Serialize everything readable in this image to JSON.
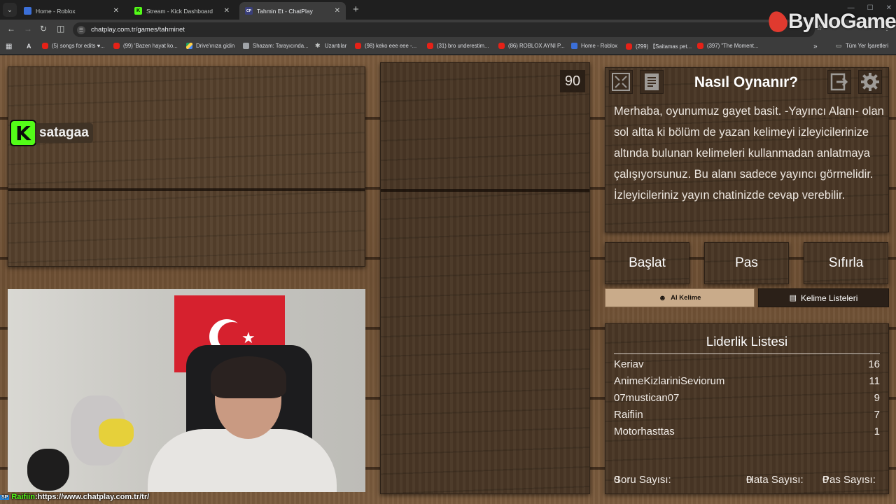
{
  "browser": {
    "tabs": [
      {
        "title": "Home - Roblox",
        "favicon": "roblox-icon",
        "color": "#3b6fd8",
        "active": false
      },
      {
        "title": "Stream - Kick Dashboard",
        "favicon": "kick-icon",
        "color": "#53fc18",
        "active": false
      },
      {
        "title": "Tahmin Et - ChatPlay",
        "favicon": "chatplay-icon",
        "color": "#6a5acd",
        "active": true
      }
    ],
    "url": "chatplay.com.tr/games/tahminet",
    "bookmarks": [
      {
        "label": "(5) songs for edits ♥...",
        "icon": "yt"
      },
      {
        "label": "(99) 'Bazen hayat ko...",
        "icon": "yt"
      },
      {
        "label": "Drive'ınıza gidin",
        "icon": "dr"
      },
      {
        "label": "Shazam: Tarayıcında...",
        "icon": "sh"
      },
      {
        "label": "Uzantılar",
        "icon": "ex"
      },
      {
        "label": "(98) keko eee eee -...",
        "icon": "yt"
      },
      {
        "label": "(31) bro underestim...",
        "icon": "yt"
      },
      {
        "label": "(86) ROBLOX AYNI P...",
        "icon": "yt"
      },
      {
        "label": "Home - Roblox",
        "icon": "rb"
      },
      {
        "label": "(299) 【Saitamas pet...",
        "icon": "yt"
      },
      {
        "label": "(397) \"The Moment...",
        "icon": "yt"
      }
    ],
    "all_bookmarks_label": "Tüm Yer İşaretleri"
  },
  "overlay_logo": "ByNoGame",
  "streamer": {
    "name": "satagaa"
  },
  "chat": {
    "badge": "SP",
    "user": "Raifiin",
    "separator": " : ",
    "message": "https://www.chatplay.com.tr/tr/"
  },
  "game": {
    "timer": "90",
    "howto_title": "Nasıl Oynanır?",
    "howto_text": "Merhaba, oyunumuz gayet basit. -Yayıncı Alanı- olan sol altta ki bölüm de yazan kelimeyi izleyicilerinize altında bulunan kelimeleri kullanmadan anlatmaya çalışıyorsunuz. Bu alanı sadece yayıncı görmelidir. İzleyicileriniz yayın chatinizde cevap verebilir.",
    "buttons": {
      "start": "Başlat",
      "pass": "Pas",
      "reset": "Sıfırla"
    },
    "get_word": "Al Kelime",
    "word_lists": "Kelime Listeleri",
    "leaderboard_title": "Liderlik Listesi",
    "leaderboard": [
      {
        "name": "Keriav",
        "score": "16"
      },
      {
        "name": "AnimeKizlariniSeviorum",
        "score": "11"
      },
      {
        "name": "07mustican07",
        "score": "9"
      },
      {
        "name": "Raifiin",
        "score": "7"
      },
      {
        "name": "Motorhasttas",
        "score": "1"
      }
    ],
    "stats": {
      "questions_label": "Soru Sayısı:",
      "questions": "0",
      "errors_label": "Hata Sayısı:",
      "errors": "0",
      "passes_label": "Pas Sayısı:",
      "passes": "0"
    }
  },
  "colors": {
    "kick_green": "#53fc18",
    "wood_dark": "#4a3726",
    "accent_button": "#c9ab8a"
  }
}
